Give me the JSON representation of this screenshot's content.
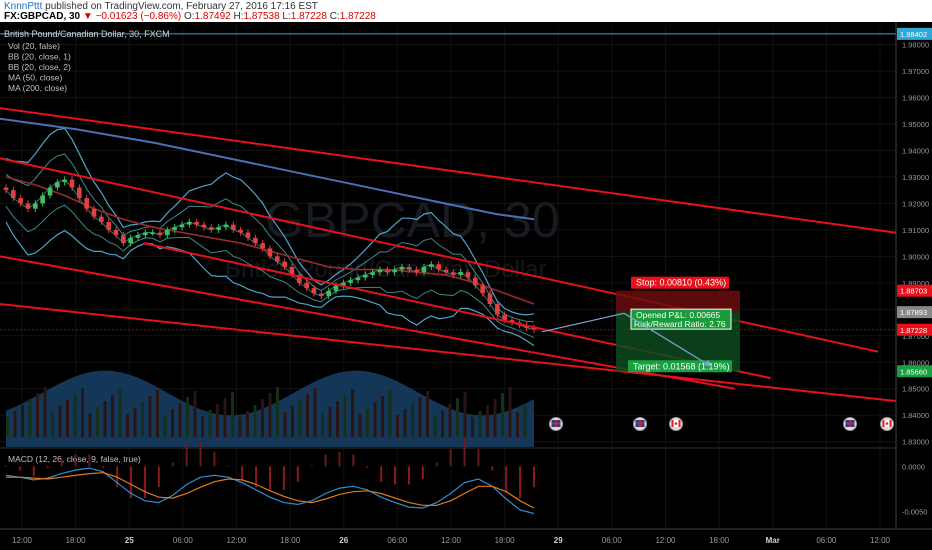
{
  "header": {
    "author": "KnnnPttt",
    "published": "published on TradingView.com, February 27, 2016 17:16 EST",
    "symbol": "FX:GBPCAD, 30",
    "change": "▼ −0.01623 (−0.86%)",
    "open_label": "O:",
    "open": "1.87492",
    "high_label": "H:",
    "high": "1.87538",
    "low_label": "L:",
    "low": "1.87228",
    "close_label": "C:",
    "close": "1.87228"
  },
  "chart_data": {
    "type": "line",
    "title": "British Pound/Canadian Dollar, 30, FXCM",
    "watermark_symbol": "GBPCAD, 30",
    "watermark_name": "British Pound/Canadian Dollar",
    "indicators": [
      "Vol (20, false)",
      "BB (20, close, 1)",
      "BB (20, close, 2)",
      "MA (50, close)",
      "MA (200, close)"
    ],
    "y_ticks": [
      "1.98000",
      "1.97000",
      "1.96000",
      "1.95000",
      "1.94000",
      "1.93000",
      "1.92000",
      "1.91000",
      "1.90000",
      "1.89000",
      "1.88000",
      "1.87000",
      "1.86000",
      "1.85000",
      "1.84000",
      "1.83000"
    ],
    "ylim": [
      1.828,
      1.987
    ],
    "price_labels": [
      {
        "text": "1.98402",
        "value": 1.98402,
        "color": "#2fa8d8"
      },
      {
        "text": "1.88703",
        "value": 1.88703,
        "color": "#e8101a"
      },
      {
        "text": "1.87893",
        "value": 1.87893,
        "color": "#888888"
      },
      {
        "text": "1.87228",
        "value": 1.87228,
        "color": "#e8101a"
      },
      {
        "text": "1.85660",
        "value": 1.8566,
        "color": "#18a040"
      }
    ],
    "x_ticks": [
      "12:00",
      "18:00",
      "25",
      "06:00",
      "12:00",
      "18:00",
      "26",
      "06:00",
      "12:00",
      "18:00",
      "29",
      "06:00",
      "12:00",
      "18:00",
      "Mar",
      "06:00",
      "12:00"
    ],
    "close_series": [
      1.925,
      1.922,
      1.92,
      1.918,
      1.92,
      1.923,
      1.926,
      1.928,
      1.929,
      1.926,
      1.922,
      1.918,
      1.915,
      1.913,
      1.91,
      1.908,
      1.905,
      1.907,
      1.908,
      1.909,
      1.909,
      1.908,
      1.91,
      1.911,
      1.912,
      1.913,
      1.912,
      1.911,
      1.91,
      1.911,
      1.912,
      1.91,
      1.909,
      1.907,
      1.905,
      1.903,
      1.9,
      1.898,
      1.896,
      1.893,
      1.89,
      1.888,
      1.886,
      1.885,
      1.887,
      1.889,
      1.89,
      1.891,
      1.892,
      1.893,
      1.894,
      1.895,
      1.894,
      1.895,
      1.896,
      1.895,
      1.894,
      1.896,
      1.897,
      1.895,
      1.894,
      1.893,
      1.894,
      1.892,
      1.889,
      1.886,
      1.882,
      1.878,
      1.876,
      1.875,
      1.874,
      1.873,
      1.8723
    ],
    "ma200_series": [
      1.952,
      1.95,
      1.948,
      1.9455,
      1.943,
      1.94,
      1.937,
      1.934,
      1.931,
      1.928,
      1.925,
      1.922,
      1.919,
      1.916,
      1.914
    ],
    "ma50_series": [
      1.93,
      1.927,
      1.923,
      1.918,
      1.914,
      1.911,
      1.909,
      1.907,
      1.905,
      1.902,
      1.899,
      1.896,
      1.895,
      1.895,
      1.894,
      1.893,
      1.89,
      1.886,
      1.882
    ],
    "trend_lines": [
      {
        "x1": 0,
        "y1": 1.956,
        "x2": 102,
        "y2": 1.908
      },
      {
        "x1": 0,
        "y1": 1.937,
        "x2": 98,
        "y2": 1.864
      },
      {
        "x1": 0,
        "y1": 1.9,
        "x2": 82,
        "y2": 1.85
      },
      {
        "x1": 16,
        "y1": 1.905,
        "x2": 86,
        "y2": 1.854
      },
      {
        "x1": 0,
        "y1": 1.882,
        "x2": 101,
        "y2": 1.845
      }
    ],
    "position": {
      "stop": "Stop: 0.00810 (0.43%)",
      "target": "Target: 0.01568 (1.19%)",
      "opened_pl": "Opened P&L: 0.00665",
      "risk_reward": "Risk/Reward Ratio: 2.76",
      "entry": 1.87893,
      "stop_price": 1.88703,
      "target_price": 1.8566
    },
    "event_flags": [
      "gb",
      "gb",
      "ca",
      "gb",
      "ca"
    ],
    "macd": {
      "label": "MACD (12, 26, close, 9, false, true)",
      "y_ticks": [
        "0.0000",
        "-0.0050"
      ],
      "ylim": [
        -0.0068,
        0.0018
      ],
      "macd_series": [
        -0.001,
        -0.0012,
        -0.0015,
        -0.0013,
        -0.0008,
        -0.0004,
        -0.0002,
        -0.0006,
        -0.0018,
        -0.003,
        -0.0038,
        -0.004,
        -0.0032,
        -0.002,
        -0.0012,
        -0.001,
        -0.0012,
        -0.0018,
        -0.0026,
        -0.0034,
        -0.004,
        -0.0042,
        -0.0038,
        -0.003,
        -0.0024,
        -0.0022,
        -0.0026,
        -0.0034,
        -0.004,
        -0.0045,
        -0.0046,
        -0.004,
        -0.003,
        -0.0018,
        -0.0014,
        -0.0022,
        -0.0036,
        -0.0048,
        -0.0052
      ],
      "signal_series": [
        -0.0012,
        -0.0012,
        -0.0013,
        -0.0014,
        -0.0012,
        -0.001,
        -0.0008,
        -0.0007,
        -0.0012,
        -0.002,
        -0.0028,
        -0.0034,
        -0.0035,
        -0.003,
        -0.0023,
        -0.0017,
        -0.0014,
        -0.0015,
        -0.002,
        -0.0027,
        -0.0033,
        -0.0038,
        -0.004,
        -0.0036,
        -0.0031,
        -0.0028,
        -0.0027,
        -0.003,
        -0.0035,
        -0.004,
        -0.0043,
        -0.0043,
        -0.0038,
        -0.003,
        -0.0022,
        -0.0022,
        -0.0028,
        -0.0038,
        -0.0046
      ]
    }
  }
}
